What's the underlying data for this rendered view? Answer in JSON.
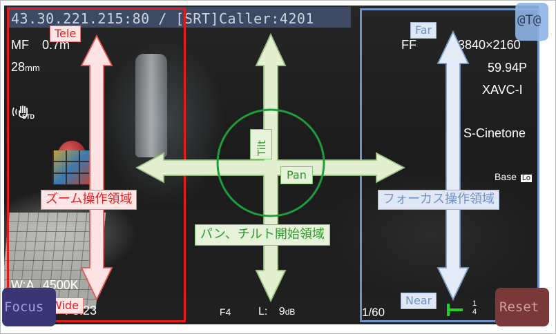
{
  "stream": {
    "address": "43.30.221.215:80 / [SRT]Caller:4201"
  },
  "camera": {
    "focus_mode": "MF",
    "focus_distance": "0.7m",
    "focal_length": "28",
    "focal_unit": "mm",
    "stabilizer_badge": "STD",
    "format_mode": "FF",
    "resolution": "3840×2160",
    "frame_rate": "59.94P",
    "codec": "XAVC-I",
    "picture_profile": "S-Cinetone",
    "iso_base": "Base",
    "iso_badge": "Lo",
    "white_balance_label": "W:A",
    "white_balance_value": "4500K",
    "f_stop_prefix": "F",
    "f_stop": "5.23",
    "iris": "F4",
    "audio_label": "L:",
    "gain": "9",
    "gain_unit": "dB",
    "shutter": "1/60",
    "audio_meter_top": "1",
    "audio_meter_bottom": "4"
  },
  "zoom_area": {
    "title": "ズーム操作領域",
    "tele_label": "Tele",
    "wide_label": "Wide"
  },
  "center_area": {
    "title": "パン、チルト開始領域",
    "tilt_label": "Tilt",
    "pan_label": "Pan"
  },
  "focus_area": {
    "title": "フォーカス操作領域",
    "far_label": "Far",
    "near_label": "Near"
  },
  "buttons": {
    "at_label": "@T@",
    "focus_label": "Focus",
    "reset_label": "Reset"
  },
  "colors": {
    "zoom": "#e31b1b",
    "pan_tilt": "#1e9e3a",
    "focus": "#6f93c5",
    "arrow_fill": "#e2efd0"
  }
}
